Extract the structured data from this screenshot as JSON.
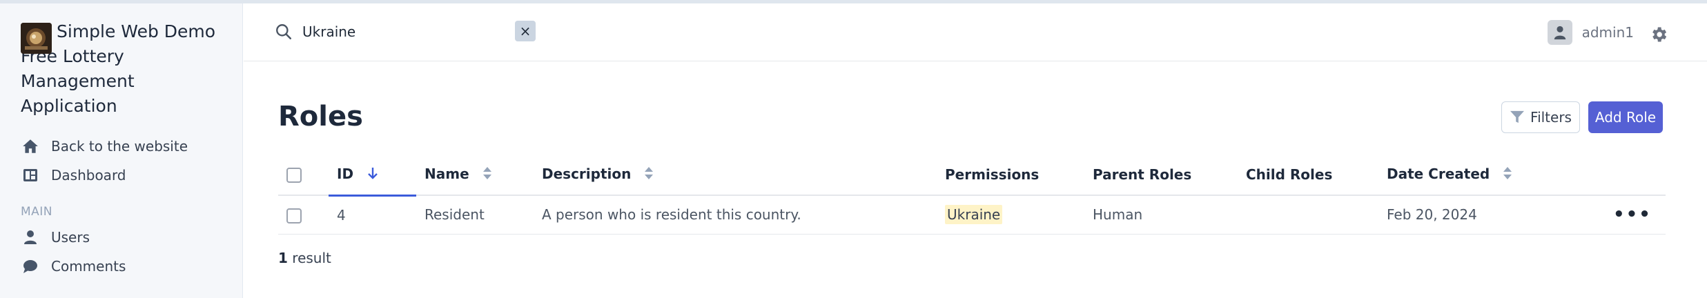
{
  "brand": {
    "line1": "Simple Web Demo",
    "line2": "Free Lottery Management",
    "line3": "Application"
  },
  "nav": {
    "items": [
      {
        "label": "Back to the website",
        "icon": "home-icon"
      },
      {
        "label": "Dashboard",
        "icon": "dashboard-icon"
      }
    ],
    "section_main": "MAIN",
    "main_items": [
      {
        "label": "Users",
        "icon": "user-icon"
      },
      {
        "label": "Comments",
        "icon": "comment-icon"
      }
    ]
  },
  "search": {
    "value": "Ukraine",
    "clear_label": "×"
  },
  "user": {
    "name": "admin1"
  },
  "page": {
    "title": "Roles",
    "filters_label": "Filters",
    "add_label": "Add Role"
  },
  "table": {
    "headers": {
      "id": "ID",
      "name": "Name",
      "description": "Description",
      "permissions": "Permissions",
      "parent_roles": "Parent Roles",
      "child_roles": "Child Roles",
      "date_created": "Date Created"
    },
    "rows": [
      {
        "id": "4",
        "name": "Resident",
        "description": "A person who is resident this country.",
        "permissions": "Ukraine",
        "parent_roles": "Human",
        "child_roles": "",
        "date_created": "Feb 20, 2024",
        "actions": "•••"
      }
    ]
  },
  "result": {
    "count": "1",
    "label": " result"
  },
  "colors": {
    "accent": "#5560d4",
    "sort_active": "#3b5bdb",
    "highlight": "#fef3c7",
    "sidebar_bg": "#f5f7fa"
  }
}
